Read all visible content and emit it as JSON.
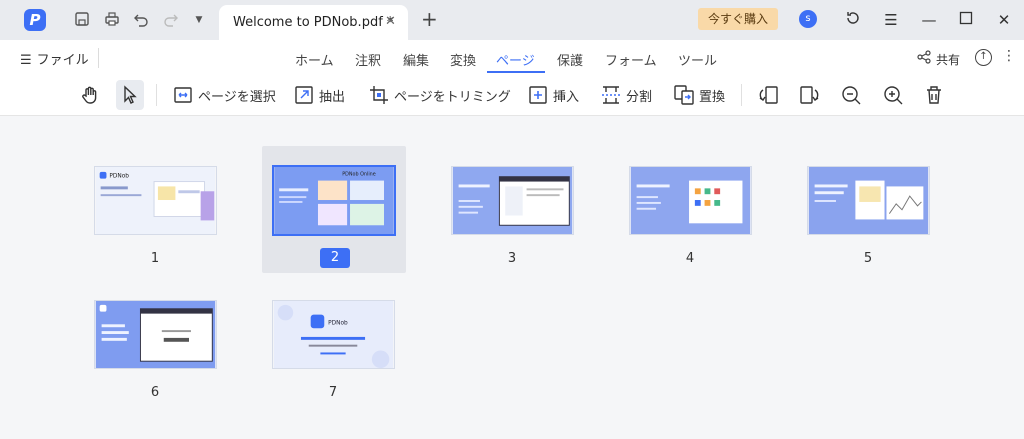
{
  "titlebar": {
    "tab_title": "Welcome to PDNob.pdf *",
    "buy_button": "今すぐ購入",
    "avatar_letter": "s"
  },
  "menu": {
    "file": "ファイル",
    "items": [
      "ホーム",
      "注釈",
      "編集",
      "変換",
      "ページ",
      "保護",
      "フォーム",
      "ツール"
    ],
    "active_index": 4,
    "share": "共有"
  },
  "toolbar": {
    "select_page": "ページを選択",
    "extract": "抽出",
    "crop": "ページをトリミング",
    "insert": "挿入",
    "split": "分割",
    "replace": "置換"
  },
  "pages": [
    {
      "number": "1",
      "text": "PDNob"
    },
    {
      "number": "2",
      "text": "PDNob Online"
    },
    {
      "number": "3"
    },
    {
      "number": "4"
    },
    {
      "number": "5"
    },
    {
      "number": "6"
    },
    {
      "number": "7",
      "text": "PDNob"
    }
  ],
  "selected_page": "2",
  "colors": {
    "accent": "#3d6ff5",
    "buy_bg": "#f9d9a8"
  }
}
